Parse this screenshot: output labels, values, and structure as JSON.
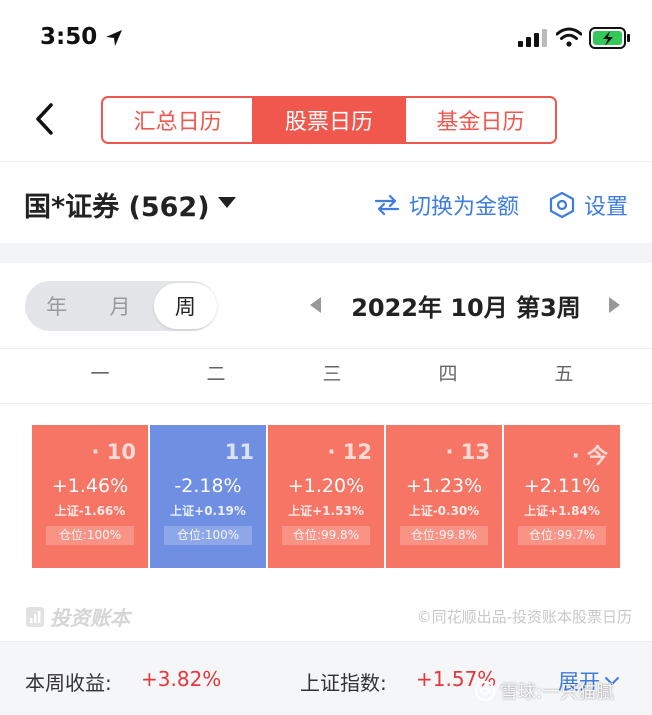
{
  "status_bar": {
    "time": "3:50"
  },
  "header": {
    "tabs": [
      {
        "label": "汇总日历",
        "active": false
      },
      {
        "label": "股票日历",
        "active": true
      },
      {
        "label": "基金日历",
        "active": false
      }
    ]
  },
  "account": {
    "name": "国*证券 (562)",
    "switch_label": "切换为金额",
    "settings_label": "设置"
  },
  "period": {
    "options": [
      "年",
      "月",
      "周"
    ],
    "selected": "周",
    "title": "2022年 10月 第3周"
  },
  "weekdays": [
    "一",
    "二",
    "三",
    "四",
    "五"
  ],
  "days": [
    {
      "date": "· 10",
      "return": "+1.46%",
      "index": "上证-1.66%",
      "position": "仓位:100%",
      "trend": "up"
    },
    {
      "date": "11",
      "return": "-2.18%",
      "index": "上证+0.19%",
      "position": "仓位:100%",
      "trend": "down"
    },
    {
      "date": "· 12",
      "return": "+1.20%",
      "index": "上证+1.53%",
      "position": "仓位:99.8%",
      "trend": "up"
    },
    {
      "date": "· 13",
      "return": "+1.23%",
      "index": "上证-0.30%",
      "position": "仓位:99.8%",
      "trend": "up"
    },
    {
      "date": "· 今",
      "return": "+2.11%",
      "index": "上证+1.84%",
      "position": "仓位:99.7%",
      "trend": "up"
    }
  ],
  "brand": {
    "logo_text": "投资账本",
    "credit": "©同花顺出品-投资账本股票日历"
  },
  "summary": {
    "week_label": "本周收益:",
    "week_value": "+3.82%",
    "index_label": "上证指数:",
    "index_value": "+1.57%",
    "expand_label": "展开"
  },
  "watermark": {
    "text": "雪球:一只猫腻"
  },
  "colors": {
    "accent_red": "#f0574d",
    "up_card": "#f77565",
    "down_card": "#6f8fe3",
    "link_blue": "#3d7de0",
    "gain_red": "#e8363a"
  }
}
